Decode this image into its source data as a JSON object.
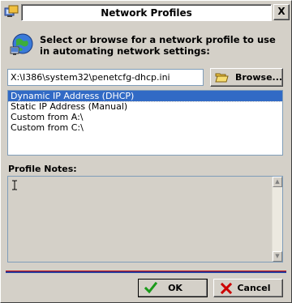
{
  "window": {
    "title": "Network Profiles",
    "close_label": "X"
  },
  "intro": {
    "text": "Select or browse for a network profile to use in automating network settings:"
  },
  "path": {
    "value": "X:\\I386\\system32\\penetcfg-dhcp.ini"
  },
  "browse": {
    "label": "Browse..."
  },
  "profiles": {
    "items": [
      "Dynamic IP Address (DHCP)",
      "Static IP Address (Manual)",
      "Custom from A:\\",
      "Custom from C:\\"
    ],
    "selected_index": 0
  },
  "notes": {
    "label": "Profile Notes:",
    "value": ""
  },
  "buttons": {
    "ok_label": "OK",
    "cancel_label": "Cancel"
  },
  "colors": {
    "selection": "#316ac5",
    "ok_check": "#1a9a1a",
    "cancel_x": "#cc0000",
    "separator_red": "#c00000",
    "separator_blue": "#2a3f9f"
  }
}
